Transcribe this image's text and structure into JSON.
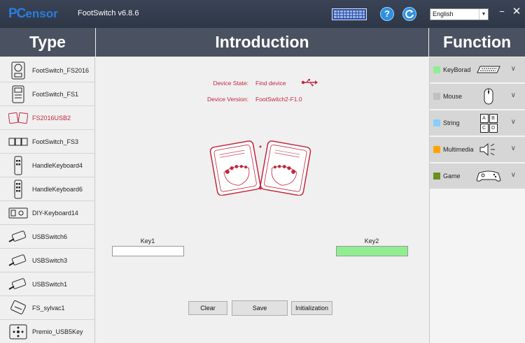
{
  "window": {
    "logo_pc": "PC",
    "logo_sensor": "ensor",
    "title": "FootSwitch v6.8.6",
    "language": "English",
    "minimize": "−",
    "close": "✕"
  },
  "headers": {
    "type": "Type",
    "introduction": "Introduction",
    "function": "Function"
  },
  "types": [
    {
      "label": "FootSwitch_FS2016",
      "icon": "footswitch-fs2016-icon",
      "active": false
    },
    {
      "label": "FootSwitch_FS1",
      "icon": "footswitch-fs1-icon",
      "active": false
    },
    {
      "label": "FS2016USB2",
      "icon": "fs2016usb2-icon",
      "active": true
    },
    {
      "label": "FootSwitch_FS3",
      "icon": "footswitch-fs3-icon",
      "active": false
    },
    {
      "label": "HandleKeyboard4",
      "icon": "handle-keyboard4-icon",
      "active": false
    },
    {
      "label": "HandleKeyboard6",
      "icon": "handle-keyboard6-icon",
      "active": false
    },
    {
      "label": "DIY-Keyboard14",
      "icon": "diy-keyboard14-icon",
      "active": false
    },
    {
      "label": "USBSwitch6",
      "icon": "usb-switch-icon",
      "active": false
    },
    {
      "label": "USBSwitch3",
      "icon": "usb-switch-icon",
      "active": false
    },
    {
      "label": "USBSwitch1",
      "icon": "usb-switch-icon",
      "active": false
    },
    {
      "label": "FS_sylvac1",
      "icon": "fs-sylvac-icon",
      "active": false
    },
    {
      "label": "Premio_USB5Key",
      "icon": "premio-usb5key-icon",
      "active": false
    }
  ],
  "device": {
    "state_label": "Device State:",
    "state_value": "Find device",
    "version_label": "Device Version:",
    "version_value": "FootSwitch2-F1.0"
  },
  "keys": {
    "key1_label": "Key1",
    "key2_label": "Key2",
    "key1_value": "",
    "key2_value": ""
  },
  "buttons": {
    "clear": "Clear",
    "save": "Save",
    "initialization": "Initialization"
  },
  "functions": [
    {
      "label": "KeyBorad",
      "color": "#90ee90",
      "icon": "keyboard-icon"
    },
    {
      "label": "Mouse",
      "color": "#c0c0c0",
      "icon": "mouse-icon"
    },
    {
      "label": "String",
      "color": "#87cefa",
      "icon": "string-abcd-icon",
      "letters": [
        "A",
        "B",
        "C",
        "D"
      ]
    },
    {
      "label": "Multimedia",
      "color": "#ffa500",
      "icon": "speaker-icon"
    },
    {
      "label": "Game",
      "color": "#6b8e23",
      "icon": "gamepad-icon"
    }
  ],
  "colors": {
    "accent_red": "#c0283c",
    "titlebar": "#2e3746",
    "header": "#4a5160"
  }
}
